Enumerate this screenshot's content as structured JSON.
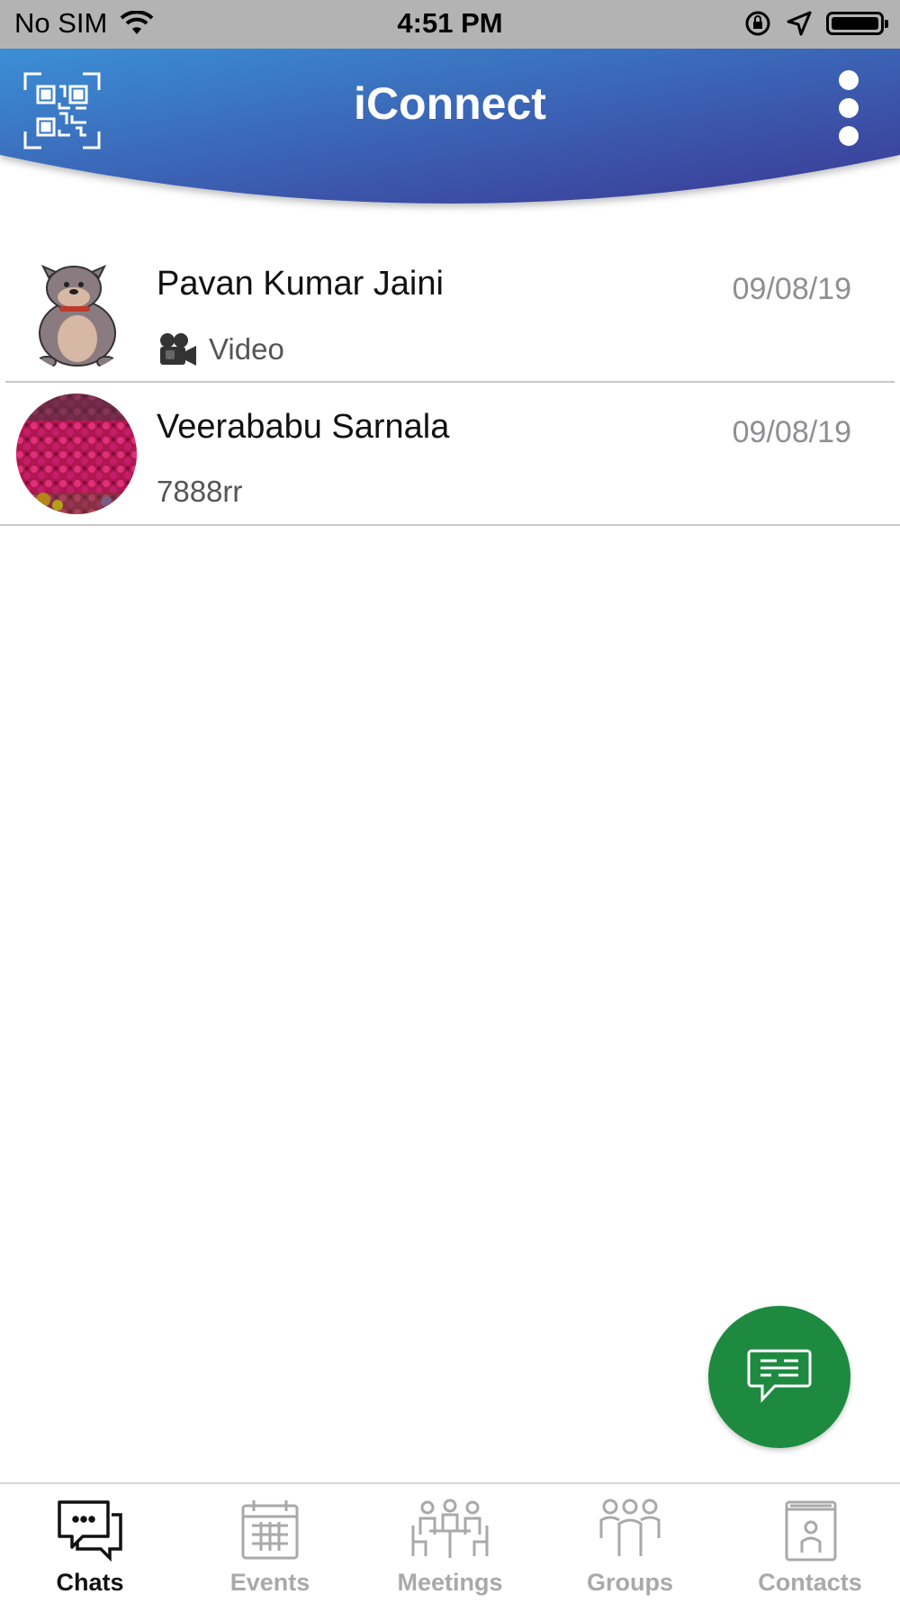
{
  "status_bar": {
    "carrier": "No SIM",
    "time": "4:51 PM"
  },
  "header": {
    "title": "iConnect",
    "gradient_start": "#3a8fd6",
    "gradient_end": "#3b3793",
    "left_icon": "qr-scan-icon",
    "right_icon": "more-vertical-icon"
  },
  "chats": [
    {
      "name": "Pavan Kumar Jaini",
      "date": "09/08/19",
      "preview": "Video",
      "preview_icon": "video-camera-icon"
    },
    {
      "name": "Veerababu Sarnala",
      "date": "09/08/19",
      "preview": "7888rr"
    }
  ],
  "fab": {
    "icon": "new-chat-icon",
    "color": "#1d8a40"
  },
  "tabs": [
    {
      "label": "Chats",
      "icon": "chat-bubbles-icon",
      "active": true
    },
    {
      "label": "Events",
      "icon": "calendar-icon",
      "active": false
    },
    {
      "label": "Meetings",
      "icon": "meeting-icon",
      "active": false
    },
    {
      "label": "Groups",
      "icon": "groups-icon",
      "active": false
    },
    {
      "label": "Contacts",
      "icon": "contacts-icon",
      "active": false
    }
  ]
}
